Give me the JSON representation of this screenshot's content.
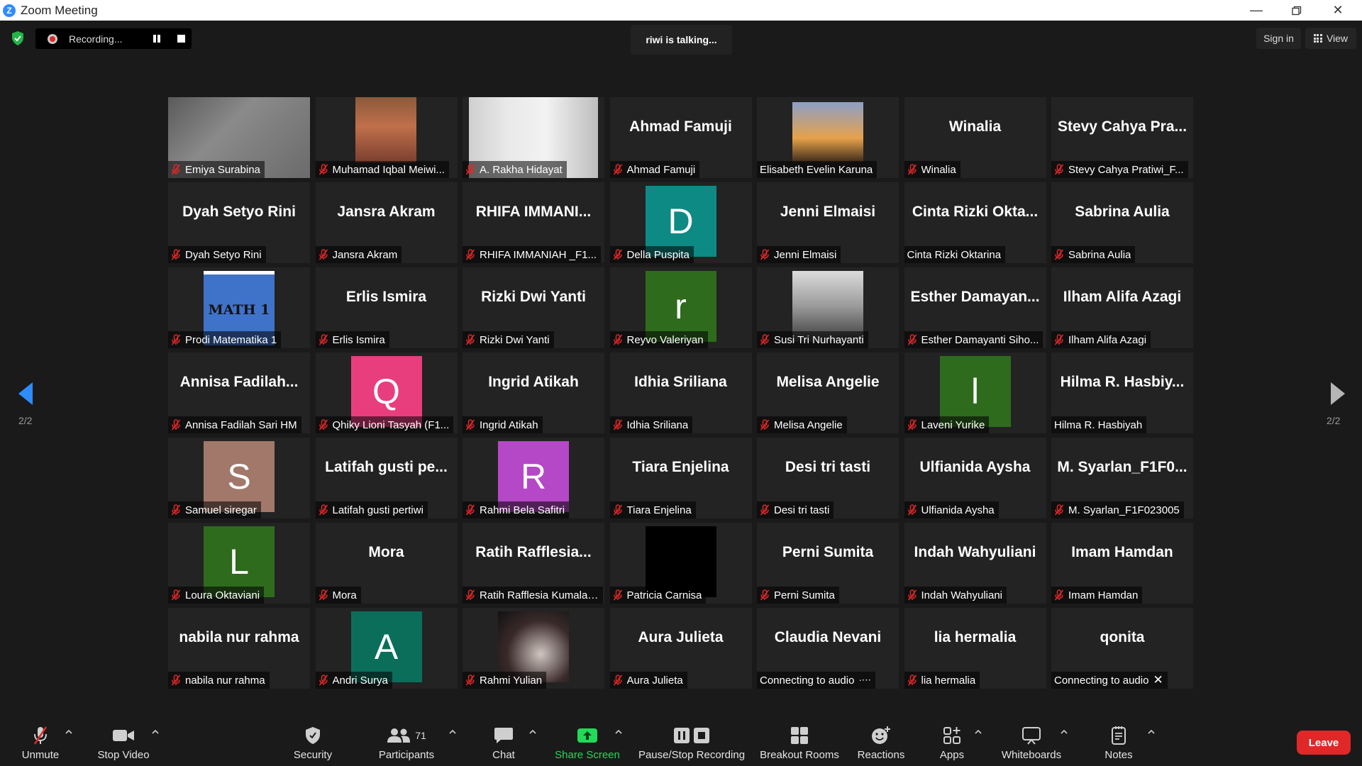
{
  "window": {
    "title": "Zoom Meeting",
    "logo_letter": "Z"
  },
  "topbar": {
    "recording_label": "Recording...",
    "talking": "riwi is talking...",
    "sign_in": "Sign in",
    "view": "View"
  },
  "gallery": {
    "page_indicator": "2/2",
    "participants": [
      {
        "name": "Emiya Surabina",
        "display": "photo",
        "muted": true
      },
      {
        "name": "Muhamad Iqbal Meiwi...",
        "display": "photo",
        "muted": true
      },
      {
        "name": "A. Rakha Hidayat",
        "display": "photo",
        "muted": true
      },
      {
        "name": "Ahmad Famuji",
        "display": "text",
        "big": "Ahmad Famuji",
        "muted": true
      },
      {
        "name": "Elisabeth Evelin Karuna",
        "display": "photo",
        "muted": false
      },
      {
        "name": "Winalia",
        "display": "text",
        "big": "Winalia",
        "muted": true
      },
      {
        "name": "Stevy Cahya Pratiwi_F...",
        "display": "text",
        "big": "Stevy Cahya Pra...",
        "muted": true
      },
      {
        "name": "Dyah Setyo Rini",
        "display": "text",
        "big": "Dyah Setyo Rini",
        "muted": true
      },
      {
        "name": "Jansra Akram",
        "display": "text",
        "big": "Jansra Akram",
        "muted": true
      },
      {
        "name": "RHIFA IMMANIAH _F1...",
        "display": "text",
        "big": "RHIFA IMMANI...",
        "muted": true
      },
      {
        "name": "Della Puspita",
        "display": "avatar",
        "letter": "D",
        "color": "#0e8a85",
        "muted": true
      },
      {
        "name": "Jenni Elmaisi",
        "display": "text",
        "big": "Jenni Elmaisi",
        "muted": true
      },
      {
        "name": "Cinta Rizki Oktarina",
        "display": "text",
        "big": "Cinta Rizki Okta...",
        "muted": false
      },
      {
        "name": "Sabrina Aulia",
        "display": "text",
        "big": "Sabrina Aulia",
        "muted": true
      },
      {
        "name": "Prodi Matematika 1",
        "display": "math",
        "photo_text": "MATH 1",
        "muted": true
      },
      {
        "name": "Erlis Ismira",
        "display": "text",
        "big": "Erlis Ismira",
        "muted": true
      },
      {
        "name": "Rizki Dwi Yanti",
        "display": "text",
        "big": "Rizki Dwi Yanti",
        "muted": true
      },
      {
        "name": "Reyvo Valeriyan",
        "display": "avatar",
        "letter": "r",
        "color": "#2e6b1d",
        "muted": true
      },
      {
        "name": "Susi Tri Nurhayanti",
        "display": "photo",
        "muted": true
      },
      {
        "name": "Esther Damayanti Siho...",
        "display": "text",
        "big": "Esther Damayan...",
        "muted": true
      },
      {
        "name": "Ilham Alifa Azagi",
        "display": "text",
        "big": "Ilham Alifa Azagi",
        "muted": true
      },
      {
        "name": "Annisa Fadilah Sari HM",
        "display": "text",
        "big": "Annisa Fadilah...",
        "muted": true
      },
      {
        "name": "Qhiky Lioni Tasyah (F1...",
        "display": "avatar",
        "letter": "Q",
        "color": "#e83e7e",
        "muted": true
      },
      {
        "name": "Ingrid Atikah",
        "display": "text",
        "big": "Ingrid Atikah",
        "muted": true
      },
      {
        "name": "Idhia Sriliana",
        "display": "text",
        "big": "Idhia Sriliana",
        "muted": true
      },
      {
        "name": "Melisa Angelie",
        "display": "text",
        "big": "Melisa Angelie",
        "muted": true
      },
      {
        "name": "Laveni Yurike",
        "display": "avatar",
        "letter": "l",
        "color": "#2e6b1d",
        "muted": true
      },
      {
        "name": "Hilma R. Hasbiyah",
        "display": "text",
        "big": "Hilma R. Hasbiy...",
        "muted": false
      },
      {
        "name": "Samuel siregar",
        "display": "avatar",
        "letter": "S",
        "color": "#a2786a",
        "muted": true
      },
      {
        "name": "Latifah gusti pertiwi",
        "display": "text",
        "big": "Latifah gusti pe...",
        "muted": true
      },
      {
        "name": "Rahmi Bela Safitri",
        "display": "avatar",
        "letter": "R",
        "color": "#b548c6",
        "muted": true
      },
      {
        "name": "Tiara Enjelina",
        "display": "text",
        "big": "Tiara Enjelina",
        "muted": true
      },
      {
        "name": "Desi tri tasti",
        "display": "text",
        "big": "Desi tri tasti",
        "muted": true
      },
      {
        "name": "Ulfianida Aysha",
        "display": "text",
        "big": "Ulfianida Aysha",
        "muted": true
      },
      {
        "name": "M. Syarlan_F1F023005",
        "display": "text",
        "big": "M. Syarlan_F1F0...",
        "muted": true
      },
      {
        "name": "Loura Oktaviani",
        "display": "avatar",
        "letter": "L",
        "color": "#2e6b1d",
        "muted": true
      },
      {
        "name": "Mora",
        "display": "text",
        "big": "Mora",
        "muted": true
      },
      {
        "name": "Ratih Rafflesia Kumala ...",
        "display": "text",
        "big": "Ratih Rafflesia...",
        "muted": true
      },
      {
        "name": "Patricia Carnisa",
        "display": "avatar",
        "letter": "",
        "color": "#000000",
        "muted": true
      },
      {
        "name": "Perni Sumita",
        "display": "text",
        "big": "Perni Sumita",
        "muted": true
      },
      {
        "name": "Indah Wahyuliani",
        "display": "text",
        "big": "Indah Wahyuliani",
        "muted": true
      },
      {
        "name": "Imam Hamdan",
        "display": "text",
        "big": "Imam Hamdan",
        "muted": true
      },
      {
        "name": "nabila nur rahma",
        "display": "text",
        "big": "nabila nur rahma",
        "muted": true
      },
      {
        "name": "Andri Surya",
        "display": "avatar",
        "letter": "A",
        "color": "#0b6e5b",
        "muted": true
      },
      {
        "name": "Rahmi Yulian",
        "display": "photo",
        "muted": true
      },
      {
        "name": "Aura Julieta",
        "display": "text",
        "big": "Aura Julieta",
        "muted": true
      },
      {
        "name": "Connecting to audio",
        "display": "text",
        "big": "Claudia Nevani",
        "muted": false,
        "status": "connecting-dots"
      },
      {
        "name": "lia hermalia",
        "display": "text",
        "big": "lia hermalia",
        "muted": true
      },
      {
        "name": "Connecting to audio",
        "display": "text",
        "big": "qonita",
        "muted": false,
        "status": "connecting-x"
      }
    ]
  },
  "toolbar": {
    "unmute": "Unmute",
    "stop_video": "Stop Video",
    "security": "Security",
    "participants": "Participants",
    "participants_count": "71",
    "chat": "Chat",
    "share_screen": "Share Screen",
    "pause_stop_recording": "Pause/Stop Recording",
    "breakout_rooms": "Breakout Rooms",
    "reactions": "Reactions",
    "apps": "Apps",
    "whiteboards": "Whiteboards",
    "notes": "Notes",
    "leave": "Leave"
  },
  "colors": {
    "share_green": "#23d959",
    "leave_red": "#e02828",
    "muted_red": "#e02828",
    "arrow_blue": "#2d8cff"
  }
}
